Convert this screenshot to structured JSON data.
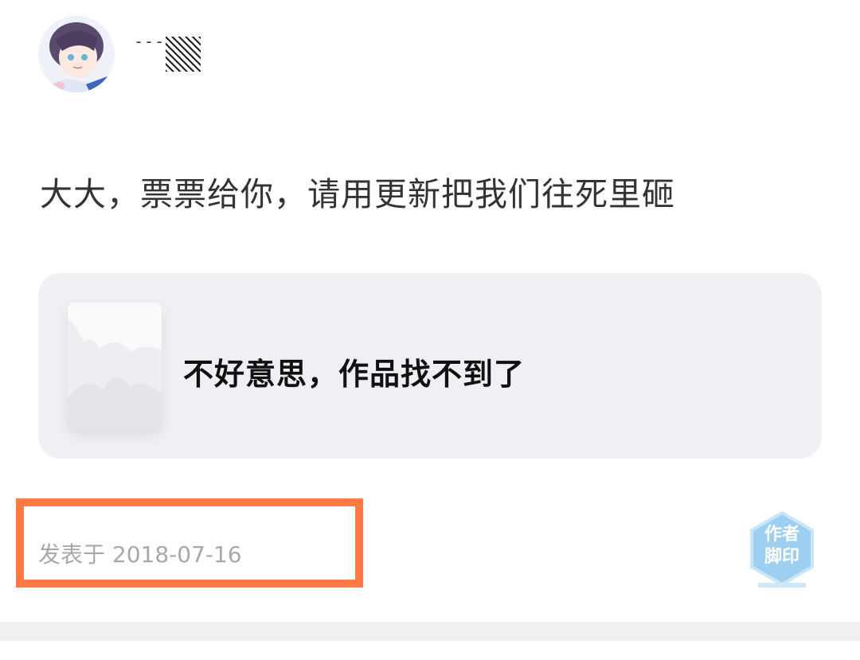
{
  "post": {
    "author_name": "---",
    "text": "大大，票票给你，请用更新把我们往死里砸",
    "date_label": "发表于 2018-07-16"
  },
  "work_card": {
    "message": "不好意思，作品找不到了"
  },
  "badge": {
    "line1": "作者",
    "line2": "脚印",
    "color": "#9ccff0"
  },
  "colors": {
    "highlight": "#ff7a45",
    "card_bg": "#eef0f4"
  }
}
